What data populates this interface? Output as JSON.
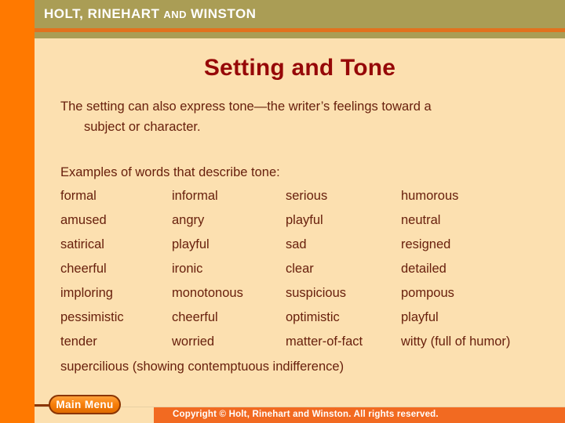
{
  "header": {
    "brand_primary": "HOLT, RINEHART",
    "brand_conjunction": "AND",
    "brand_secondary": "WINSTON"
  },
  "slide": {
    "title": "Setting and Tone",
    "intro_line1": "The setting can also express tone—the writer’s feelings toward a",
    "intro_line2": "subject or character.",
    "examples_label": "Examples of words that describe tone:",
    "word_rows": [
      [
        "formal",
        "informal",
        "serious",
        "humorous"
      ],
      [
        "amused",
        "angry",
        "playful",
        "neutral"
      ],
      [
        "satirical",
        "playful",
        "sad",
        "resigned"
      ],
      [
        "cheerful",
        "ironic",
        "clear",
        "detailed"
      ],
      [
        "imploring",
        "monotonous",
        "suspicious",
        "pompous"
      ],
      [
        "pessimistic",
        "cheerful",
        "optimistic",
        "playful"
      ],
      [
        "tender",
        "worried",
        "matter-of-fact",
        "witty (full of humor)"
      ]
    ],
    "footnote": "supercilious (showing contemptuous indifference)"
  },
  "footer": {
    "main_menu_label": "Main Menu",
    "copyright": "Copyright © Holt, Rinehart and Winston. All rights reserved."
  },
  "colors": {
    "accent_orange": "#FF7900",
    "header_olive": "#AA9D55",
    "stripe_orange": "#E2721E",
    "page_cream": "#FCE0B0",
    "title_maroon": "#960808",
    "body_brown": "#68200D",
    "copyright_orange": "#F26A21",
    "button_border": "#8A3503"
  }
}
